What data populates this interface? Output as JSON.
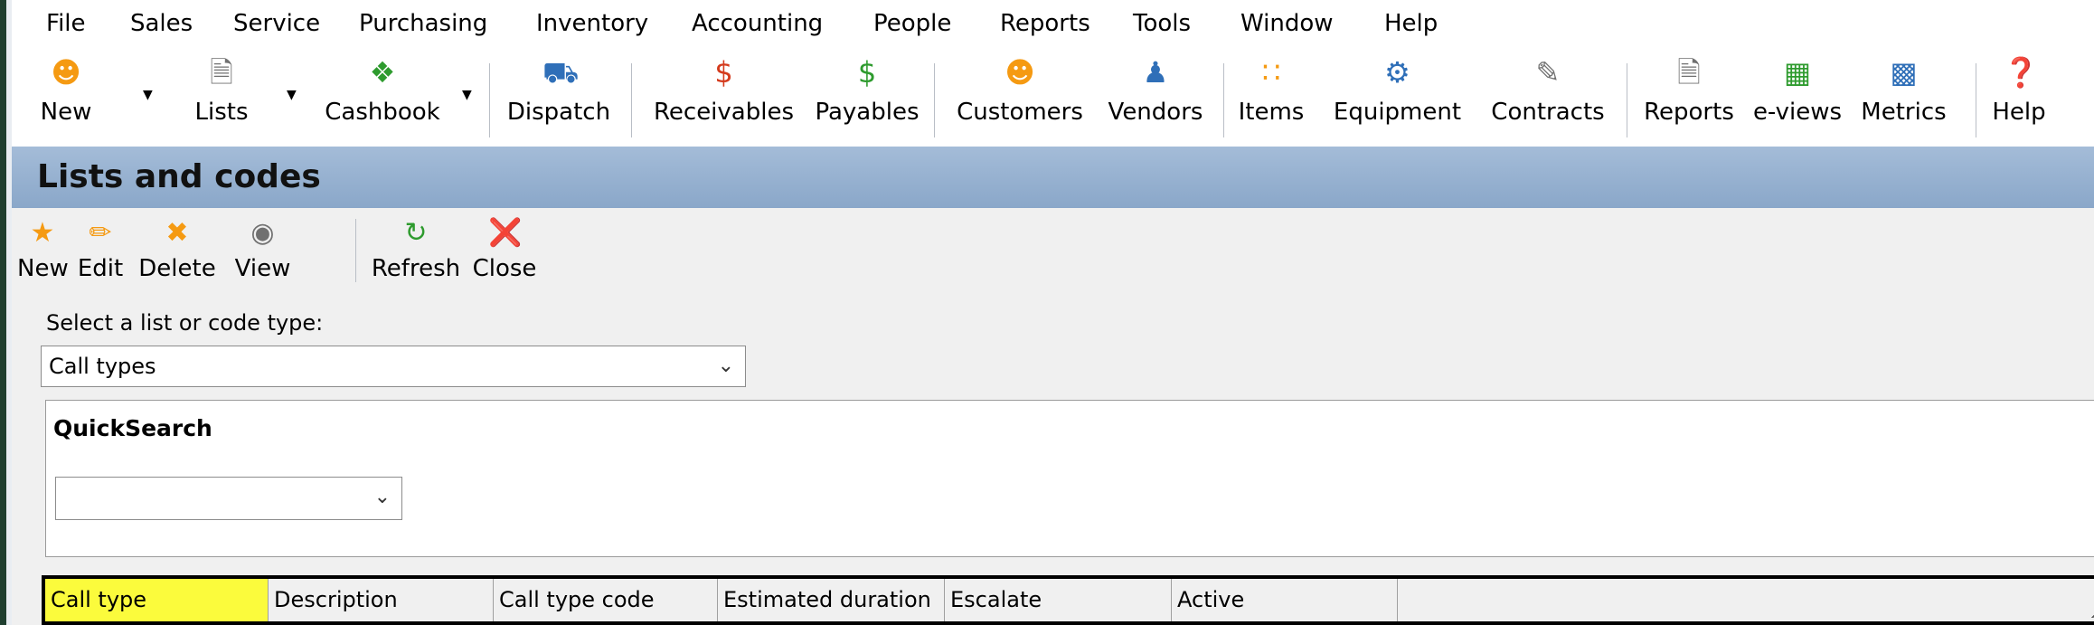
{
  "menu": [
    "File",
    "Sales",
    "Service",
    "Purchasing",
    "Inventory",
    "Accounting",
    "People",
    "Reports",
    "Tools",
    "Window",
    "Help"
  ],
  "toolbar": [
    {
      "label": "New",
      "icon": "new-people-icon",
      "dropdown": true
    },
    {
      "label": "Lists",
      "icon": "lists-icon",
      "dropdown": true
    },
    {
      "label": "Cashbook",
      "icon": "cashbook-icon",
      "dropdown": true
    },
    {
      "label": "Dispatch",
      "icon": "dispatch-truck-icon"
    },
    {
      "label": "Receivables",
      "icon": "receivables-dollar-icon"
    },
    {
      "label": "Payables",
      "icon": "payables-dollar-icon"
    },
    {
      "label": "Customers",
      "icon": "customers-icon"
    },
    {
      "label": "Vendors",
      "icon": "vendors-icon"
    },
    {
      "label": "Items",
      "icon": "items-icon"
    },
    {
      "label": "Equipment",
      "icon": "equipment-icon"
    },
    {
      "label": "Contracts",
      "icon": "contracts-icon"
    },
    {
      "label": "Reports",
      "icon": "reports-icon"
    },
    {
      "label": "e-views",
      "icon": "e-views-icon"
    },
    {
      "label": "Metrics",
      "icon": "metrics-icon"
    },
    {
      "label": "Help",
      "icon": "help-icon"
    }
  ],
  "header": {
    "title": "Lists and codes"
  },
  "subtoolbar": [
    {
      "label": "New",
      "icon": "star-icon"
    },
    {
      "label": "Edit",
      "icon": "pencil-icon"
    },
    {
      "label": "Delete",
      "icon": "delete-x-icon"
    },
    {
      "label": "View",
      "icon": "binoculars-icon"
    },
    {
      "label": "Refresh",
      "icon": "refresh-icon"
    },
    {
      "label": "Close",
      "icon": "close-icon"
    }
  ],
  "selector": {
    "label": "Select a list or code type:",
    "value": "Call types"
  },
  "quicksearch": {
    "label": "QuickSearch",
    "value": ""
  },
  "grid": {
    "columns": [
      "Call type",
      "Description",
      "Call type code",
      "Estimated duration",
      "Escalate",
      "Active"
    ],
    "highlight_color": "#fbfb3c"
  }
}
